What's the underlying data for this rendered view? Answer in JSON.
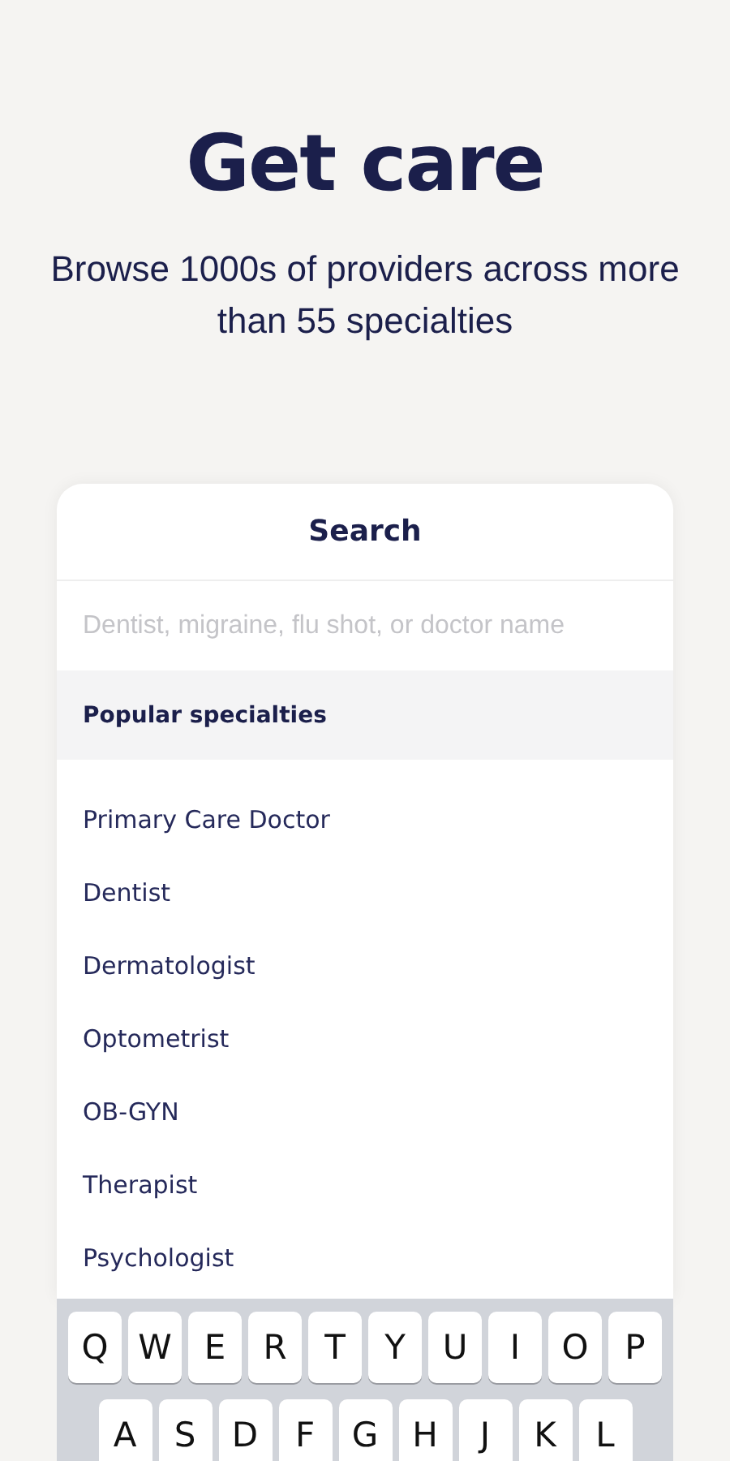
{
  "hero": {
    "title": "Get care",
    "subtitle": "Browse 1000s of providers across more than 55 specialties"
  },
  "search_card": {
    "title": "Search",
    "placeholder": "Dentist, migraine, flu shot, or doctor name",
    "section_heading": "Popular specialties",
    "items": [
      "Primary Care Doctor",
      "Dentist",
      "Dermatologist",
      "Optometrist",
      "OB-GYN",
      "Therapist",
      "Psychologist"
    ]
  },
  "keyboard": {
    "rows": [
      [
        "Q",
        "W",
        "E",
        "R",
        "T",
        "Y",
        "U",
        "I",
        "O",
        "P"
      ],
      [
        "A",
        "S",
        "D",
        "F",
        "G",
        "H",
        "J",
        "K",
        "L"
      ]
    ]
  }
}
